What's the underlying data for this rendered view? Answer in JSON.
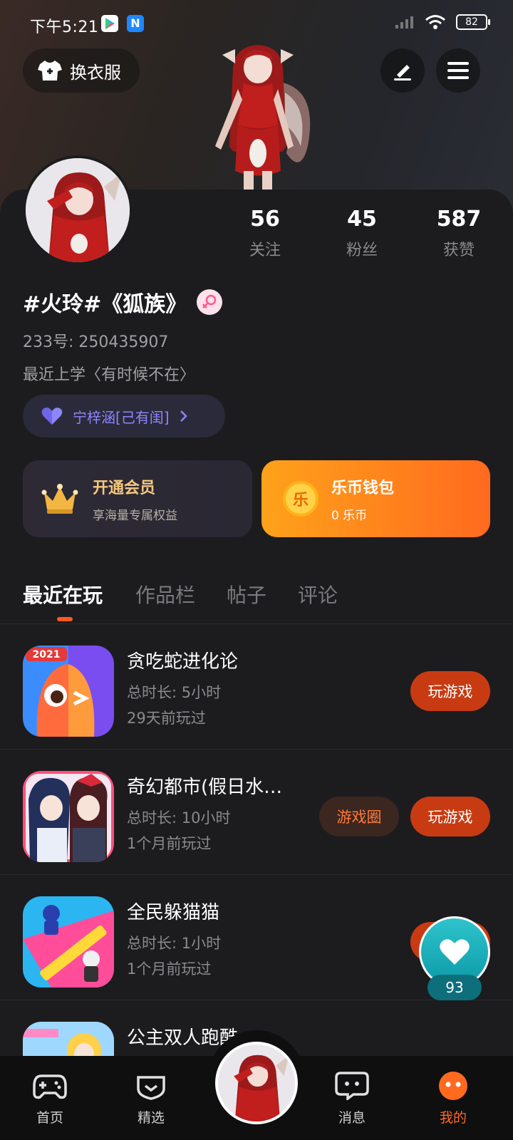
{
  "status": {
    "time": "下午5:21",
    "battery": "82"
  },
  "header": {
    "outfit_label": "换衣服"
  },
  "profile": {
    "stats": [
      {
        "value": "56",
        "label": "关注"
      },
      {
        "value": "45",
        "label": "粉丝"
      },
      {
        "value": "587",
        "label": "获赞"
      }
    ],
    "nickname": "#火玲#《狐族》",
    "uid": "233号: 250435907",
    "bio": "最近上学〈有时候不在〉",
    "relation": "宁梓涵[己有闺]",
    "gender": "female"
  },
  "cards": {
    "vip": {
      "title": "开通会员",
      "subtitle": "享海量专属权益"
    },
    "wallet": {
      "title": "乐币钱包",
      "subtitle": "0 乐币",
      "coin_glyph": "乐"
    }
  },
  "tabs": [
    "最近在玩",
    "作品栏",
    "帖子",
    "评论"
  ],
  "games": [
    {
      "name": "贪吃蛇进化论",
      "duration": "总时长: 5小时",
      "last": "29天前玩过",
      "play": "玩游戏",
      "year_badge": "2021"
    },
    {
      "name": "奇幻都市(假日水…",
      "duration": "总时长: 10小时",
      "last": "1个月前玩过",
      "play": "玩游戏",
      "circle": "游戏圈"
    },
    {
      "name": "全民躲猫猫",
      "duration": "总时长: 1小时",
      "last": "1个月前玩过",
      "play": "玩游戏"
    },
    {
      "name": "公主双人跑酷…",
      "duration": "",
      "last": "",
      "play": ""
    }
  ],
  "float_like": {
    "count": "93"
  },
  "nav": {
    "home": "首页",
    "featured": "精选",
    "messages": "消息",
    "me": "我的"
  },
  "colors": {
    "accent": "#ff6a1f",
    "play_button": "#c83b12",
    "vip_gold": "#f5c77e",
    "relation_purple": "#8c86ff"
  }
}
